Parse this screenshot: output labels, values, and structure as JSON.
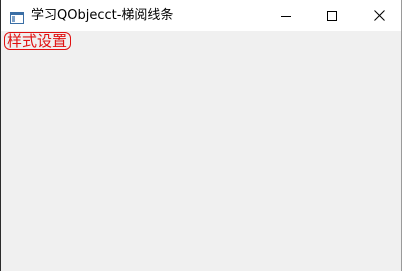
{
  "window": {
    "title": "学习QObjecct-梯阅线条",
    "app_icon": "window-app-icon",
    "buttons": {
      "minimize": "minimize-icon",
      "maximize": "maximize-icon",
      "close": "close-icon"
    }
  },
  "content": {
    "label_text": "样式设置",
    "label_color": "#e01010",
    "background_color": "#f0f0f0"
  }
}
